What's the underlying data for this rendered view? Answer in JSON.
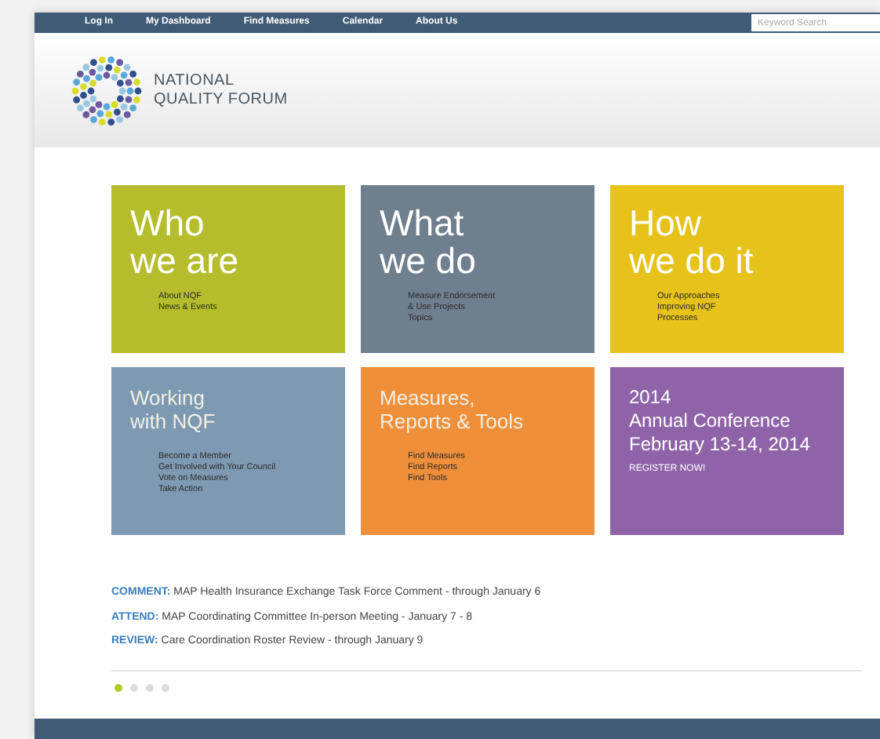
{
  "nav": {
    "items": [
      "Log In",
      "My Dashboard",
      "Find Measures",
      "Calendar",
      "About Us"
    ],
    "search": {
      "placeholder": "Keyword Search"
    }
  },
  "header": {
    "logo_lines": [
      "NATIONAL",
      "QUALITY FORUM"
    ]
  },
  "tiles": [
    {
      "kind": "section",
      "color": "#b5bd2c",
      "title": [
        "Who",
        "we are"
      ],
      "links": [
        "About NQF",
        "News & Events"
      ]
    },
    {
      "kind": "section",
      "color": "#6f7f8e",
      "title": [
        "What",
        "we do"
      ],
      "links": [
        "Measure Endorsement",
        "& Use Projects",
        "Topics"
      ]
    },
    {
      "kind": "section",
      "color": "#e6c21a",
      "title": [
        "How",
        "we do it"
      ],
      "links": [
        "Our Approaches",
        "Improving NQF",
        "Processes"
      ]
    },
    {
      "kind": "small",
      "color": "#7d9ab2",
      "title": [
        "Working",
        "with NQF"
      ],
      "links": [
        "Become a Member",
        "Get Involved with Your Council",
        "Vote on Measures",
        "Take Action"
      ]
    },
    {
      "kind": "small",
      "color": "#ef8f3a",
      "title": [
        "Measures,",
        "Reports & Tools"
      ],
      "links": [
        "Find Measures",
        "Find Reports",
        "Find Tools"
      ]
    },
    {
      "kind": "event",
      "color": "#8f63a8",
      "title": [
        "2014",
        "Annual Conference",
        "February 13-14, 2014"
      ],
      "links": [
        "REGISTER NOW!"
      ]
    }
  ],
  "announcements": [
    {
      "label": "COMMENT:",
      "text": "MAP Health Insurance Exchange Task Force Comment - through January 6"
    },
    {
      "label": "ATTEND:",
      "text": "MAP Coordinating Committee In-person Meeting - January 7 - 8"
    },
    {
      "label": "REVIEW:",
      "text": "Care Coordination Roster Review - through January 9"
    }
  ],
  "pager": [
    {
      "selected": true
    },
    {
      "selected": false
    },
    {
      "selected": false
    },
    {
      "selected": false
    }
  ]
}
